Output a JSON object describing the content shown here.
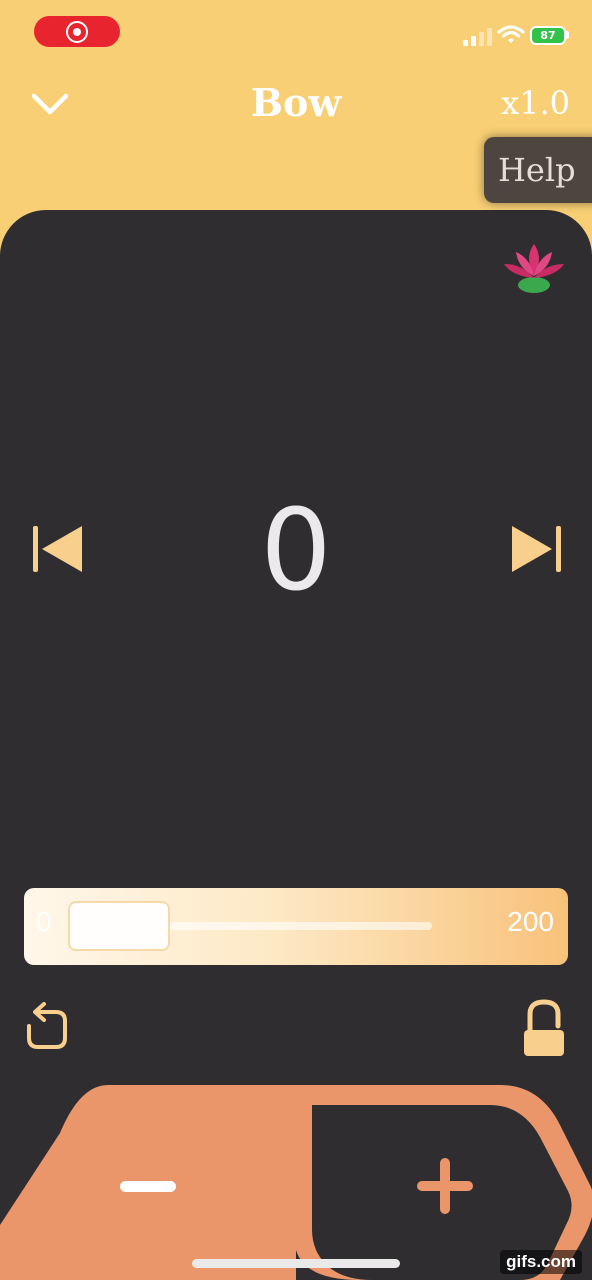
{
  "status": {
    "battery": "87"
  },
  "header": {
    "title": "Bow",
    "speed": "x1.0",
    "help_label": "Help"
  },
  "counter": {
    "value": "0"
  },
  "slider": {
    "min_label": "0",
    "max_label": "200",
    "value": 0
  },
  "watermark": "gifs.com",
  "colors": {
    "background": "#f8cf74",
    "panel": "#302d31",
    "accent": "#ea966a",
    "icon_peach": "#f9cf8d"
  },
  "icons": [
    "chevron-down-icon",
    "lotus-icon",
    "skip-previous-icon",
    "skip-next-icon",
    "reset-icon",
    "lock-icon",
    "minus-icon",
    "plus-icon"
  ]
}
